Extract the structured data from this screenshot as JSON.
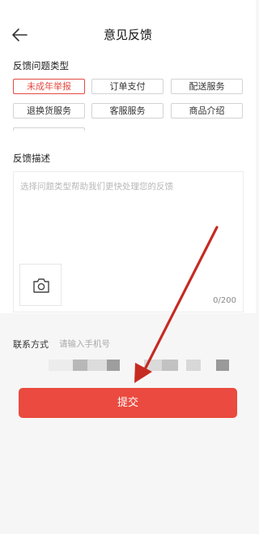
{
  "header": {
    "title": "意见反馈",
    "back_icon": "arrow-left-icon"
  },
  "feedback_type": {
    "label": "反馈问题类型",
    "options": [
      "未成年举报",
      "订单支付",
      "配送服务",
      "退换货服务",
      "客服服务",
      "商品介绍"
    ],
    "selected": "未成年举报"
  },
  "description": {
    "label": "反馈描述",
    "placeholder": "选择问题类型帮助我们更快处理您的反馈",
    "counter": "0/200",
    "photo_icon": "camera-icon"
  },
  "contact": {
    "label": "联系方式",
    "placeholder": "请输入手机号"
  },
  "submit": {
    "label": "提交"
  },
  "colors": {
    "accent": "#ea4a3f",
    "arrow": "#c62b22",
    "chip_active": "#e34a40"
  }
}
